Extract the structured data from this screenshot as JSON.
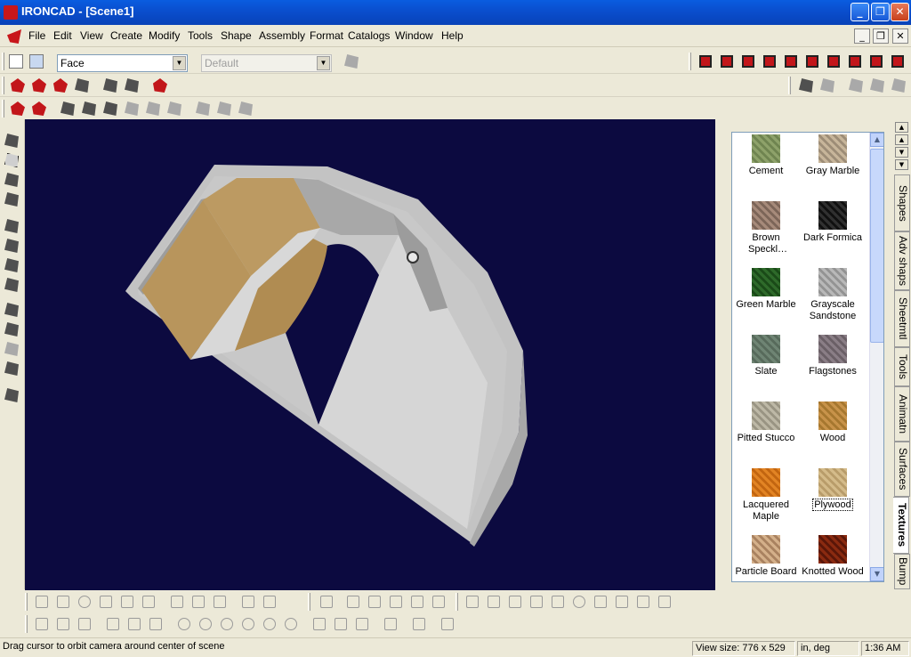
{
  "window": {
    "title": "IRONCAD - [Scene1]",
    "minimize": "_",
    "maximize": "❐",
    "close": "✕"
  },
  "menubar": {
    "items": [
      "File",
      "Edit",
      "View",
      "Create",
      "Modify",
      "Tools",
      "Shape",
      "Assembly",
      "Format",
      "Catalogs",
      "Window",
      "Help"
    ],
    "mdi_minimize": "_",
    "mdi_restore": "❐",
    "mdi_close": "✕"
  },
  "toolbar": {
    "selection_filter": "Face",
    "style_combo": "Default"
  },
  "catalog": {
    "items": [
      {
        "label": "Cement",
        "color": "#8ea26a",
        "color2": "#6f8450"
      },
      {
        "label": "Gray Marble",
        "color": "#c7b59a",
        "color2": "#9d8d77"
      },
      {
        "label": "Brown Speckl…",
        "color": "#a68a7a",
        "color2": "#7c6558"
      },
      {
        "label": "Dark Formica",
        "color": "#303030",
        "color2": "#101010"
      },
      {
        "label": "Green Marble",
        "color": "#2e6a2a",
        "color2": "#1a4a18"
      },
      {
        "label": "Grayscale Sandstone",
        "color": "#b8b8b8",
        "color2": "#939393"
      },
      {
        "label": "Slate",
        "color": "#6f8574",
        "color2": "#576a5b"
      },
      {
        "label": "Flagstones",
        "color": "#8a7e86",
        "color2": "#6a5f66"
      },
      {
        "label": "Pitted Stucco",
        "color": "#bdb8a6",
        "color2": "#999483"
      },
      {
        "label": "Wood",
        "color": "#c8934a",
        "color2": "#a6772f"
      },
      {
        "label": "Lacquered Maple",
        "color": "#e28424",
        "color2": "#c26510"
      },
      {
        "label": "Plywood",
        "color": "#d4bb8a",
        "color2": "#b89c6a"
      },
      {
        "label": "Particle Board",
        "color": "#d4b08a",
        "color2": "#a98260"
      },
      {
        "label": "Knotted Wood",
        "color": "#8a2a10",
        "color2": "#5a1608"
      }
    ],
    "selected_index": 11,
    "tabs": [
      "Shapes",
      "Adv shaps",
      "Sheetmtl",
      "Tools",
      "Animatn",
      "Surfaces",
      "Textures",
      "Bump"
    ],
    "active_tab": "Textures"
  },
  "status": {
    "message": "Drag cursor to orbit camera around center of scene",
    "view_size": "View size:  776 x  529",
    "units": "in, deg",
    "time": "1:36 AM"
  },
  "colors": {
    "viewport_background": "#0c0a40",
    "part_surface": "#c9c9c9",
    "plywood_texture": "#b8955c"
  }
}
